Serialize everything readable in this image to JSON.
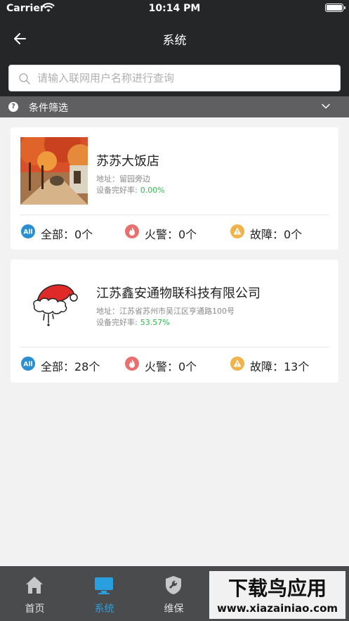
{
  "status": {
    "carrier": "Carrier",
    "time": "10:14 PM"
  },
  "nav": {
    "title": "系统"
  },
  "search": {
    "placeholder": "请输入联网用户名称进行查询"
  },
  "filter": {
    "label": "条件筛选"
  },
  "cards": [
    {
      "name": "苏苏大饭店",
      "address": "地址：留园旁边",
      "rate_label": "设备完好率:",
      "rate_value": "0.00%",
      "stats": {
        "all": "全部：0个",
        "fire": "火警：0个",
        "fault": "故障：0个"
      }
    },
    {
      "name": "江苏鑫安通物联科技有限公司",
      "address": "地址：江苏省苏州市吴江区亨通路100号",
      "rate_label": "设备完好率:",
      "rate_value": "53.57%",
      "stats": {
        "all": "全部：28个",
        "fire": "火警：0个",
        "fault": "故障：13个"
      }
    }
  ],
  "tabbar": {
    "items": [
      {
        "label": "首页",
        "icon": "home-icon"
      },
      {
        "label": "系统",
        "icon": "monitor-icon",
        "active": true
      },
      {
        "label": "维保",
        "icon": "wrench-shield-icon"
      }
    ]
  },
  "watermark": {
    "title": "下载鸟应用",
    "url": "www.xiazainiao.com"
  },
  "colors": {
    "nav_bg": "#252628",
    "filter_bg": "#5f5f61",
    "tabbar_bg": "#4a4b4d",
    "accent_blue": "#2a9fe0",
    "good_green": "#2bbf4b",
    "fire_red": "#e8706f",
    "fault_orange": "#f0b24a"
  }
}
